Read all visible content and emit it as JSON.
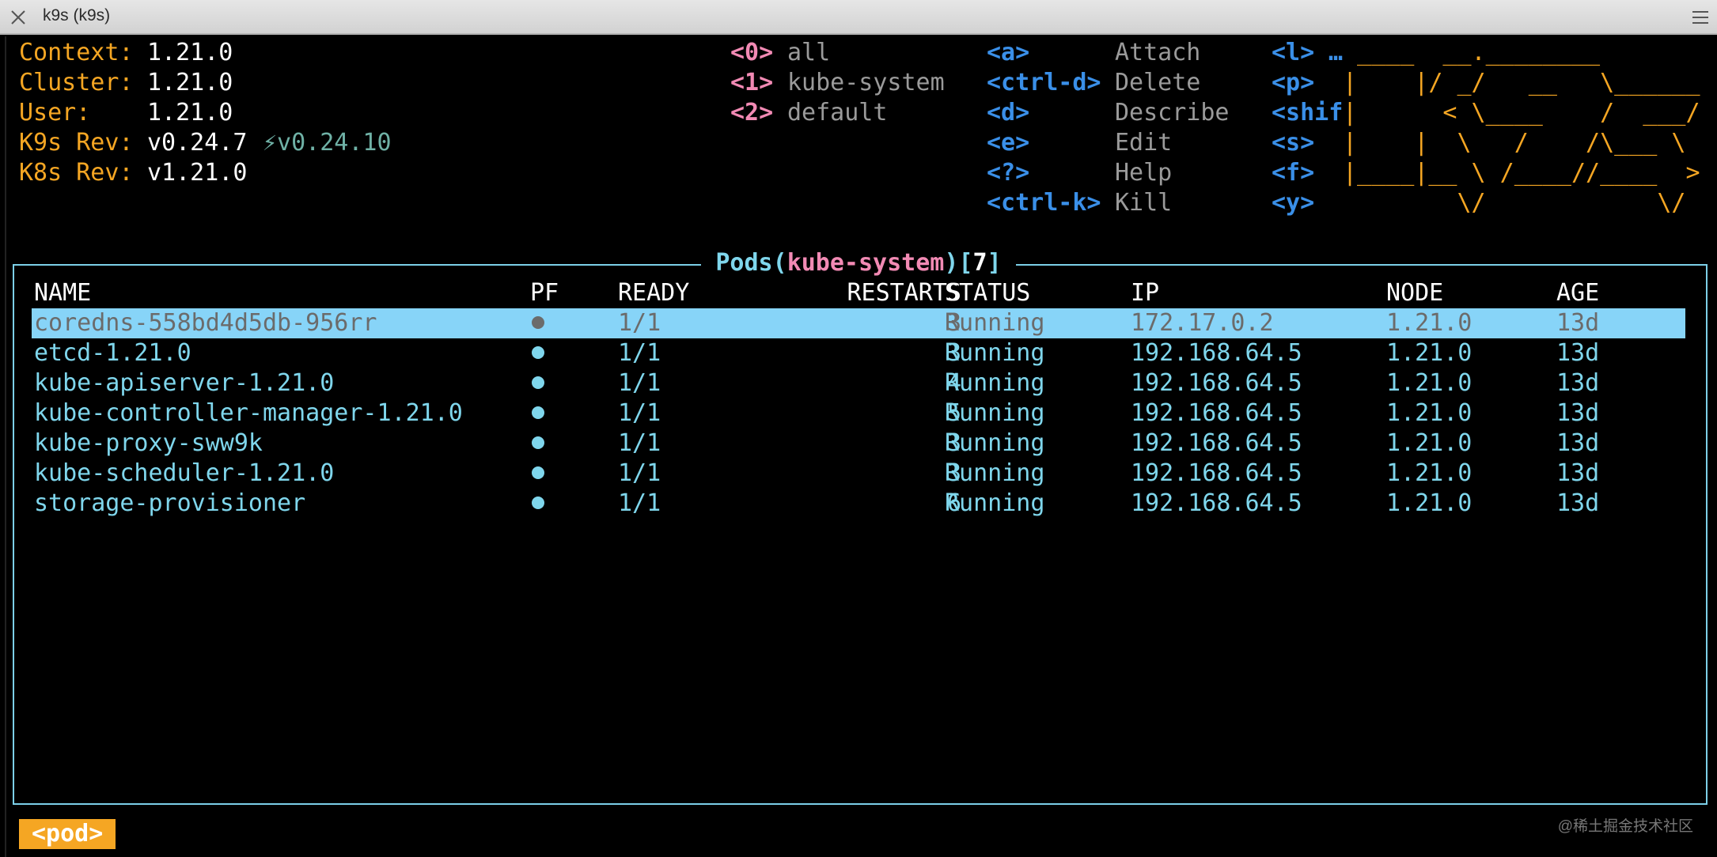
{
  "window": {
    "title": "k9s (k9s)"
  },
  "info": {
    "context_label": "Context:",
    "context_value": "1.21.0",
    "cluster_label": "Cluster:",
    "cluster_value": "1.21.0",
    "user_label": "User:",
    "user_value": "1.21.0",
    "k9s_label": "K9s Rev:",
    "k9s_value": "v0.24.7",
    "k9s_update": "⚡v0.24.10",
    "k8s_label": "K8s Rev:",
    "k8s_value": "v1.21.0"
  },
  "namespaces": [
    {
      "key": "<0>",
      "name": "all"
    },
    {
      "key": "<1>",
      "name": "kube-system"
    },
    {
      "key": "<2>",
      "name": "default"
    }
  ],
  "shortcuts": [
    {
      "key": "<a>",
      "action": "Attach"
    },
    {
      "key": "<ctrl-d>",
      "action": "Delete"
    },
    {
      "key": "<d>",
      "action": "Describe"
    },
    {
      "key": "<e>",
      "action": "Edit"
    },
    {
      "key": "<?>",
      "action": "Help"
    },
    {
      "key": "<ctrl-k>",
      "action": "Kill"
    }
  ],
  "shortcuts_right": [
    {
      "key": "<l>",
      "action": "…"
    },
    {
      "key": "<p>",
      "action": ""
    },
    {
      "key": "<shif",
      "action": ""
    },
    {
      "key": "<s>",
      "action": ""
    },
    {
      "key": "<f>",
      "action": ""
    },
    {
      "key": "<y>",
      "action": ""
    }
  ],
  "logo_lines": [
    " ____  __.________       ",
    "|    |/ _/   __   \\______",
    "|      < \\____    /  ___/",
    "|    |  \\   /    /\\___ \\ ",
    "|____|__ \\ /____//____  >",
    "        \\/            \\/ "
  ],
  "panel": {
    "title_resource": "Pods",
    "title_open": "(",
    "title_namespace": "kube-system",
    "title_close": ")",
    "title_count_open": "[",
    "title_count": "7",
    "title_count_close": "]"
  },
  "columns": {
    "name": "NAME",
    "pf": "PF",
    "ready": "READY",
    "restarts": "RESTARTS",
    "status": "STATUS",
    "ip": "IP",
    "node": "NODE",
    "age": "AGE"
  },
  "pods": [
    {
      "name": "coredns-558bd4d5db-956rr",
      "ready": "1/1",
      "restarts": "3",
      "status": "Running",
      "ip": "172.17.0.2",
      "node": "1.21.0",
      "age": "13d",
      "selected": true
    },
    {
      "name": "etcd-1.21.0",
      "ready": "1/1",
      "restarts": "3",
      "status": "Running",
      "ip": "192.168.64.5",
      "node": "1.21.0",
      "age": "13d"
    },
    {
      "name": "kube-apiserver-1.21.0",
      "ready": "1/1",
      "restarts": "4",
      "status": "Running",
      "ip": "192.168.64.5",
      "node": "1.21.0",
      "age": "13d"
    },
    {
      "name": "kube-controller-manager-1.21.0",
      "ready": "1/1",
      "restarts": "5",
      "status": "Running",
      "ip": "192.168.64.5",
      "node": "1.21.0",
      "age": "13d"
    },
    {
      "name": "kube-proxy-sww9k",
      "ready": "1/1",
      "restarts": "3",
      "status": "Running",
      "ip": "192.168.64.5",
      "node": "1.21.0",
      "age": "13d"
    },
    {
      "name": "kube-scheduler-1.21.0",
      "ready": "1/1",
      "restarts": "3",
      "status": "Running",
      "ip": "192.168.64.5",
      "node": "1.21.0",
      "age": "13d"
    },
    {
      "name": "storage-provisioner",
      "ready": "1/1",
      "restarts": "6",
      "status": "Running",
      "ip": "192.168.64.5",
      "node": "1.21.0",
      "age": "13d"
    }
  ],
  "breadcrumb": "<pod>",
  "watermark": "@稀土掘金技术社区",
  "colors": {
    "orange": "#f5a623",
    "cyan": "#7fd6ec",
    "pink": "#f28ab4",
    "blue": "#3a8fe8",
    "selection": "#87d4f8"
  }
}
